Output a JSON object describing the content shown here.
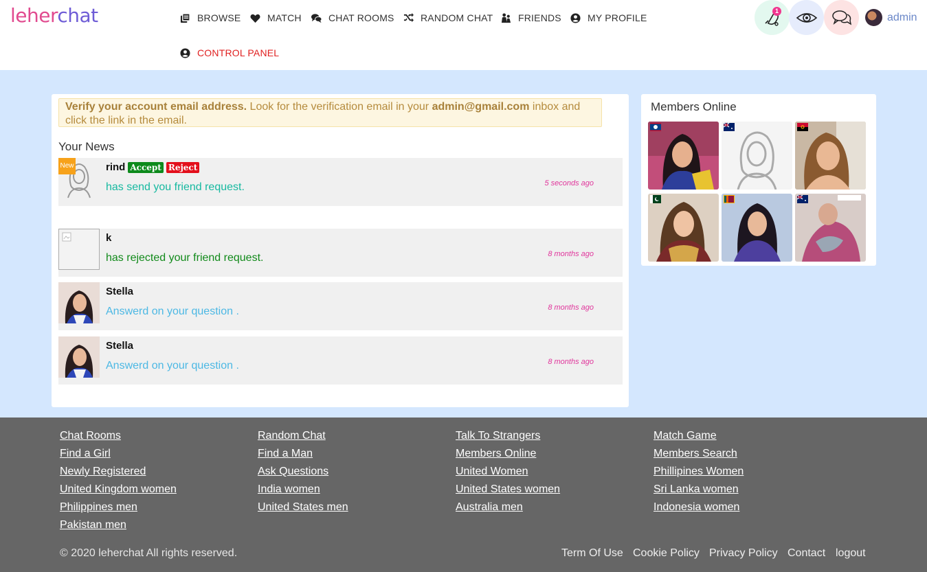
{
  "brand": {
    "part1": "leher",
    "part2": "chat"
  },
  "nav": {
    "browse": "BROWSE",
    "match": "MATCH",
    "chat_rooms": "CHAT ROOMS",
    "random_chat": "RANDOM CHAT",
    "friends": "FRIENDS",
    "my_profile": "MY PROFILE",
    "control_panel": "CONTROL PANEL"
  },
  "header": {
    "notification_count": "1",
    "username": "admin",
    "icons": [
      "bell-icon",
      "eye-icon",
      "chat-bubble-icon"
    ],
    "colors": {
      "bell_bg": "#e3f8ef",
      "eye_bg": "#e6ecfc",
      "chat_bg": "#fde3e3"
    }
  },
  "verify": {
    "bold": "Verify your account email address.",
    "text1": " Look for the verification email in your ",
    "email": "admin@gmail.com",
    "text2": " inbox and click the link in the email."
  },
  "news": {
    "title": "Your News",
    "new_label": "New",
    "accept_label": "Accept",
    "reject_label": "Reject",
    "items": [
      {
        "name": "rind",
        "message": "has send you friend request.",
        "time": "5 seconds ago",
        "color": "#16b9a0"
      },
      {
        "name": "k",
        "message": "has rejected your friend request.",
        "time": "8 months ago",
        "color": "#118a1a"
      },
      {
        "name": "Stella",
        "message": "Answerd on your question .",
        "time": "8 months ago",
        "color": "#4cb8e4"
      },
      {
        "name": "Stella",
        "message": "Answerd on your question .",
        "time": "8 months ago",
        "color": "#4cb8e4"
      }
    ]
  },
  "members": {
    "title": "Members Online",
    "flags": [
      "belize-flag-icon",
      "australia-flag-icon",
      "angola-flag-icon",
      "pakistan-flag-icon",
      "sri-lanka-flag-icon",
      "australia-flag-icon"
    ]
  },
  "footer": {
    "col1": [
      "Chat Rooms",
      "Find a Girl",
      "Newly Registered",
      "United Kingdom women",
      "Philippines men",
      "Pakistan men"
    ],
    "col2": [
      "Random Chat",
      "Find a Man",
      "Ask Questions",
      "India women",
      "United States men"
    ],
    "col3": [
      "Talk To Strangers",
      "Members Online",
      "United Women",
      "United States women",
      "Australia men"
    ],
    "col4": [
      "Match Game",
      "Members Search",
      "Phillipines Women",
      "Sri Lanka women",
      "Indonesia women"
    ],
    "copyright": "© 2020 leherchat All rights reserved.",
    "bottom_links": [
      "Term Of Use",
      "Cookie Policy",
      "Privacy Policy",
      "Contact",
      "logout"
    ]
  }
}
